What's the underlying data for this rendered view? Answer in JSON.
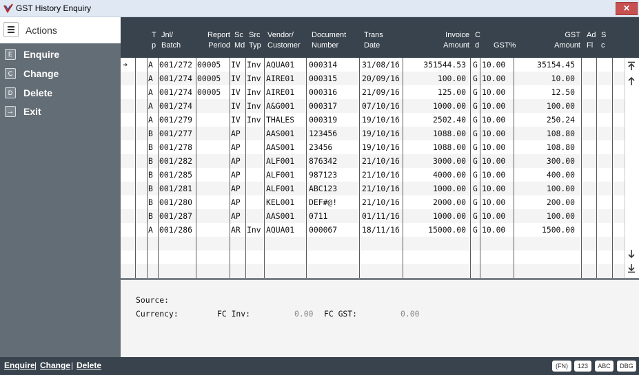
{
  "window": {
    "title": "GST History Enquiry",
    "close_glyph": "✕"
  },
  "sidebar": {
    "header_label": "Actions",
    "items": [
      {
        "key": "E",
        "label": "Enquire"
      },
      {
        "key": "C",
        "label": "Change"
      },
      {
        "key": "D",
        "label": "Delete"
      },
      {
        "key": "→",
        "label": "Exit",
        "icon": "exit-icon"
      }
    ]
  },
  "grid": {
    "columns": [
      {
        "key": "tp",
        "label": "T\np"
      },
      {
        "key": "batch",
        "label": "Jnl/\nBatch"
      },
      {
        "key": "period",
        "label": "Report\nPeriod"
      },
      {
        "key": "scmd",
        "label": "Sc\nMd"
      },
      {
        "key": "srctyp",
        "label": "Src\nTyp"
      },
      {
        "key": "vendor",
        "label": "Vendor/\nCustomer"
      },
      {
        "key": "doc",
        "label": "Document\nNumber"
      },
      {
        "key": "date",
        "label": "Trans\nDate"
      },
      {
        "key": "inv",
        "label": "Invoice\nAmount"
      },
      {
        "key": "cd",
        "label": "C\nd"
      },
      {
        "key": "gstpct",
        "label": "GST%"
      },
      {
        "key": "gstamt",
        "label": "GST\nAmount"
      },
      {
        "key": "adfl",
        "label": "Ad\nFl"
      },
      {
        "key": "sc",
        "label": "S\nc"
      }
    ],
    "rows": [
      {
        "tp": "A",
        "batch": "001/272",
        "period": "00005",
        "scmd": "IV",
        "srctyp": "Inv",
        "vendor": "AQUA01",
        "doc": "000314",
        "date": "31/08/16",
        "inv": "351544.53",
        "cd": "G",
        "gstpct": "10.00",
        "gstamt": "35154.45"
      },
      {
        "tp": "A",
        "batch": "001/274",
        "period": "00005",
        "scmd": "IV",
        "srctyp": "Inv",
        "vendor": "AIRE01",
        "doc": "000315",
        "date": "20/09/16",
        "inv": "100.00",
        "cd": "G",
        "gstpct": "10.00",
        "gstamt": "10.00"
      },
      {
        "tp": "A",
        "batch": "001/274",
        "period": "00005",
        "scmd": "IV",
        "srctyp": "Inv",
        "vendor": "AIRE01",
        "doc": "000316",
        "date": "21/09/16",
        "inv": "125.00",
        "cd": "G",
        "gstpct": "10.00",
        "gstamt": "12.50"
      },
      {
        "tp": "A",
        "batch": "001/274",
        "period": "",
        "scmd": "IV",
        "srctyp": "Inv",
        "vendor": "A&G001",
        "doc": "000317",
        "date": "07/10/16",
        "inv": "1000.00",
        "cd": "G",
        "gstpct": "10.00",
        "gstamt": "100.00"
      },
      {
        "tp": "A",
        "batch": "001/279",
        "period": "",
        "scmd": "IV",
        "srctyp": "Inv",
        "vendor": "THALES",
        "doc": "000319",
        "date": "19/10/16",
        "inv": "2502.40",
        "cd": "G",
        "gstpct": "10.00",
        "gstamt": "250.24"
      },
      {
        "tp": "B",
        "batch": "001/277",
        "period": "",
        "scmd": "AP",
        "srctyp": "",
        "vendor": "AAS001",
        "doc": "123456",
        "date": "19/10/16",
        "inv": "1088.00",
        "cd": "G",
        "gstpct": "10.00",
        "gstamt": "108.80"
      },
      {
        "tp": "B",
        "batch": "001/278",
        "period": "",
        "scmd": "AP",
        "srctyp": "",
        "vendor": "AAS001",
        "doc": "23456",
        "date": "19/10/16",
        "inv": "1088.00",
        "cd": "G",
        "gstpct": "10.00",
        "gstamt": "108.80"
      },
      {
        "tp": "B",
        "batch": "001/282",
        "period": "",
        "scmd": "AP",
        "srctyp": "",
        "vendor": "ALF001",
        "doc": "876342",
        "date": "21/10/16",
        "inv": "3000.00",
        "cd": "G",
        "gstpct": "10.00",
        "gstamt": "300.00"
      },
      {
        "tp": "B",
        "batch": "001/285",
        "period": "",
        "scmd": "AP",
        "srctyp": "",
        "vendor": "ALF001",
        "doc": "987123",
        "date": "21/10/16",
        "inv": "4000.00",
        "cd": "G",
        "gstpct": "10.00",
        "gstamt": "400.00"
      },
      {
        "tp": "B",
        "batch": "001/281",
        "period": "",
        "scmd": "AP",
        "srctyp": "",
        "vendor": "ALF001",
        "doc": "ABC123",
        "date": "21/10/16",
        "inv": "1000.00",
        "cd": "G",
        "gstpct": "10.00",
        "gstamt": "100.00"
      },
      {
        "tp": "B",
        "batch": "001/280",
        "period": "",
        "scmd": "AP",
        "srctyp": "",
        "vendor": "KEL001",
        "doc": "DEF#@!",
        "date": "21/10/16",
        "inv": "2000.00",
        "cd": "G",
        "gstpct": "10.00",
        "gstamt": "200.00"
      },
      {
        "tp": "B",
        "batch": "001/287",
        "period": "",
        "scmd": "AP",
        "srctyp": "",
        "vendor": "AAS001",
        "doc": "0711",
        "date": "01/11/16",
        "inv": "1000.00",
        "cd": "G",
        "gstpct": "10.00",
        "gstamt": "100.00"
      },
      {
        "tp": "A",
        "batch": "001/286",
        "period": "",
        "scmd": "AR",
        "srctyp": "Inv",
        "vendor": "AQUA01",
        "doc": "000067",
        "date": "18/11/16",
        "inv": "15000.00",
        "cd": "G",
        "gstpct": "10.00",
        "gstamt": "1500.00"
      }
    ],
    "selected_row": 0,
    "pointer_glyph": "➔"
  },
  "detail": {
    "source_label": "Source:",
    "currency_label": "Currency:",
    "fc_inv_label": "FC Inv:",
    "fc_inv_value": "0.00",
    "fc_gst_label": "FC GST:",
    "fc_gst_value": "0.00"
  },
  "statusbar": {
    "links": [
      "Enquire",
      "Change",
      "Delete"
    ],
    "separator": "|",
    "buttons": [
      "(FN)",
      "123",
      "ABC",
      "DBG"
    ]
  },
  "colors": {
    "header_bg": "#38434d",
    "sidebar_bg": "#636d75",
    "close_red": "#c75050",
    "row_alt": "#f4f4f4"
  }
}
